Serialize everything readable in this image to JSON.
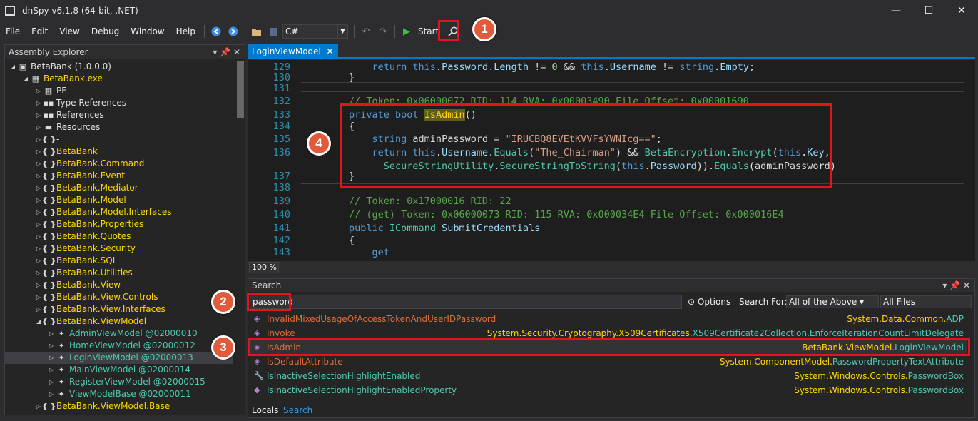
{
  "window": {
    "title": "dnSpy v6.1.8 (64-bit, .NET)",
    "minimize": "—",
    "maximize": "☐",
    "close": "✕"
  },
  "menu": [
    "File",
    "Edit",
    "View",
    "Debug",
    "Window",
    "Help"
  ],
  "toolbar": {
    "language": "C#",
    "start_label": "Start"
  },
  "badges": [
    "1",
    "2",
    "3",
    "4"
  ],
  "explorer": {
    "title": "Assembly Explorer",
    "items": [
      {
        "label": "BetaBank (1.0.0.0)",
        "color": "w",
        "depth": 0,
        "icon": "▣",
        "tw": "◢"
      },
      {
        "label": "BetaBank.exe",
        "color": "y",
        "depth": 1,
        "icon": "▦",
        "tw": "◢"
      },
      {
        "label": "PE",
        "color": "w",
        "depth": 2,
        "icon": "▦",
        "tw": "▷"
      },
      {
        "label": "Type References",
        "color": "w",
        "depth": 2,
        "icon": "▪▪",
        "tw": "▷"
      },
      {
        "label": "References",
        "color": "w",
        "depth": 2,
        "icon": "▪▪",
        "tw": "▷"
      },
      {
        "label": "Resources",
        "color": "w",
        "depth": 2,
        "icon": "▬",
        "tw": "▷"
      },
      {
        "label": "-",
        "color": "w",
        "depth": 2,
        "icon": "{ }",
        "tw": "▷"
      },
      {
        "label": "BetaBank",
        "color": "y",
        "depth": 2,
        "icon": "{ }",
        "tw": "▷"
      },
      {
        "label": "BetaBank.Command",
        "color": "y",
        "depth": 2,
        "icon": "{ }",
        "tw": "▷"
      },
      {
        "label": "BetaBank.Event",
        "color": "y",
        "depth": 2,
        "icon": "{ }",
        "tw": "▷"
      },
      {
        "label": "BetaBank.Mediator",
        "color": "y",
        "depth": 2,
        "icon": "{ }",
        "tw": "▷"
      },
      {
        "label": "BetaBank.Model",
        "color": "y",
        "depth": 2,
        "icon": "{ }",
        "tw": "▷"
      },
      {
        "label": "BetaBank.Model.Interfaces",
        "color": "y",
        "depth": 2,
        "icon": "{ }",
        "tw": "▷"
      },
      {
        "label": "BetaBank.Properties",
        "color": "y",
        "depth": 2,
        "icon": "{ }",
        "tw": "▷"
      },
      {
        "label": "BetaBank.Quotes",
        "color": "y",
        "depth": 2,
        "icon": "{ }",
        "tw": "▷"
      },
      {
        "label": "BetaBank.Security",
        "color": "y",
        "depth": 2,
        "icon": "{ }",
        "tw": "▷"
      },
      {
        "label": "BetaBank.SQL",
        "color": "y",
        "depth": 2,
        "icon": "{ }",
        "tw": "▷"
      },
      {
        "label": "BetaBank.Utilities",
        "color": "y",
        "depth": 2,
        "icon": "{ }",
        "tw": "▷"
      },
      {
        "label": "BetaBank.View",
        "color": "y",
        "depth": 2,
        "icon": "{ }",
        "tw": "▷"
      },
      {
        "label": "BetaBank.View.Controls",
        "color": "y",
        "depth": 2,
        "icon": "{ }",
        "tw": "▷"
      },
      {
        "label": "BetaBank.View.Interfaces",
        "color": "y",
        "depth": 2,
        "icon": "{ }",
        "tw": "▷"
      },
      {
        "label": "BetaBank.ViewModel",
        "color": "y",
        "depth": 2,
        "icon": "{ }",
        "tw": "◢"
      },
      {
        "label": "AdminViewModel @02000010",
        "color": "t",
        "depth": 3,
        "icon": "✦",
        "tw": "▷"
      },
      {
        "label": "HomeViewModel @02000012",
        "color": "t",
        "depth": 3,
        "icon": "✦",
        "tw": "▷"
      },
      {
        "label": "LoginViewModel @02000013",
        "color": "t",
        "depth": 3,
        "icon": "✦",
        "tw": "▷",
        "selected": true
      },
      {
        "label": "MainViewModel @02000014",
        "color": "t",
        "depth": 3,
        "icon": "✦",
        "tw": "▷"
      },
      {
        "label": "RegisterViewModel @02000015",
        "color": "t",
        "depth": 3,
        "icon": "✦",
        "tw": "▷"
      },
      {
        "label": "ViewModelBase @02000011",
        "color": "t",
        "depth": 3,
        "icon": "✦",
        "tw": "▷"
      },
      {
        "label": "BetaBank.ViewModel.Base",
        "color": "y",
        "depth": 2,
        "icon": "{ }",
        "tw": "▷"
      }
    ]
  },
  "editor": {
    "tab": "LoginViewModel",
    "zoom": "100 %",
    "lines": [
      {
        "n": "129",
        "html": "    <span class='kw'>return this</span>.<span class='pr'>Password</span>.<span class='pr'>Length</span> != <span class='nm'>0</span> &amp;&amp; <span class='kw'>this</span>.<span class='pr'>Username</span> != <span class='kw'>string</span>.<span class='pr'>Empty</span>;"
      },
      {
        "n": "130",
        "html": "}"
      },
      {
        "n": "131",
        "html": ""
      },
      {
        "n": "132",
        "html": "<span class='cm'>// Token: 0x06000072 RID: 114 RVA: 0x00003490 File Offset: 0x00001690</span>"
      },
      {
        "n": "133",
        "html": "<span class='kw'>private bool</span> <span class='hlname'>IsAdmin</span>()"
      },
      {
        "n": "134",
        "html": "{"
      },
      {
        "n": "135",
        "html": "    <span class='kw'>string</span> adminPassword = <span class='st'>\"IRUCBQ8EVEtKVVFsYWNIcg==\"</span>;"
      },
      {
        "n": "136",
        "html": "    <span class='kw'>return this</span>.<span class='pr'>Username</span>.<span class='ty'>Equals</span>(<span class='st'>\"The_Chairman\"</span>) &amp;&amp; <span class='ty'>BetaEncryption</span>.<span class='ty'>Encrypt</span>(<span class='kw'>this</span>.<span class='pr'>Key</span>,"
      },
      {
        "n": "",
        "html": "      <span class='ty'>SecureStringUtility</span>.<span class='ty'>SecureStringToString</span>(<span class='kw'>this</span>.<span class='pr'>Password</span>)).<span class='ty'>Equals</span>(adminPassword)"
      },
      {
        "n": "137",
        "html": "}"
      },
      {
        "n": "138",
        "html": ""
      },
      {
        "n": "139",
        "html": "<span class='cm'>// Token: 0x17000016 RID: 22</span>"
      },
      {
        "n": "140",
        "html": "<span class='cm'>// (get) Token: 0x06000073 RID: 115 RVA: 0x000034E4 File Offset: 0x000016E4</span>"
      },
      {
        "n": "141",
        "html": "<span class='kw'>public</span> <span class='ty'>ICommand</span> <span class='pr'>SubmitCredentials</span>"
      },
      {
        "n": "142",
        "html": "{"
      },
      {
        "n": "143",
        "html": "    <span class='kw'>get</span>"
      }
    ]
  },
  "search": {
    "title": "Search",
    "query": "password",
    "options_label": "Options",
    "search_for_label": "Search For:",
    "search_for_value": "All of the Above",
    "scope_value": "All Files",
    "results": [
      {
        "name": "InvalidMixedUsageOfAccessTokenAndUserIDPassword",
        "ncolor": "or",
        "ns": "System.Data.Common.",
        "type": "ADP",
        "icon": "◈"
      },
      {
        "name": "Invoke",
        "ncolor": "or",
        "ns": "System.Security.Cryptography.X509Certificates.",
        "type": "X509Certificate2Collection.EnforceIterationCountLimitDelegate",
        "icon": "◈"
      },
      {
        "name": "IsAdmin",
        "ncolor": "or",
        "ns": "BetaBank.ViewModel.",
        "type": "LoginViewModel",
        "icon": "◈",
        "selected": true
      },
      {
        "name": "IsDefaultAttribute",
        "ncolor": "or",
        "ns": "System.ComponentModel.",
        "type": "PasswordPropertyTextAttribute",
        "icon": "◈"
      },
      {
        "name": "IsInactiveSelectionHighlightEnabled",
        "ncolor": "t",
        "ns": "System.Windows.Controls.",
        "type": "PasswordBox",
        "icon": "🔧"
      },
      {
        "name": "IsInactiveSelectionHighlightEnabledProperty",
        "ncolor": "t",
        "ns": "System.Windows.Controls.",
        "type": "PasswordBox",
        "icon": "◆"
      }
    ],
    "bottom_tabs": [
      "Locals",
      "Search"
    ]
  }
}
